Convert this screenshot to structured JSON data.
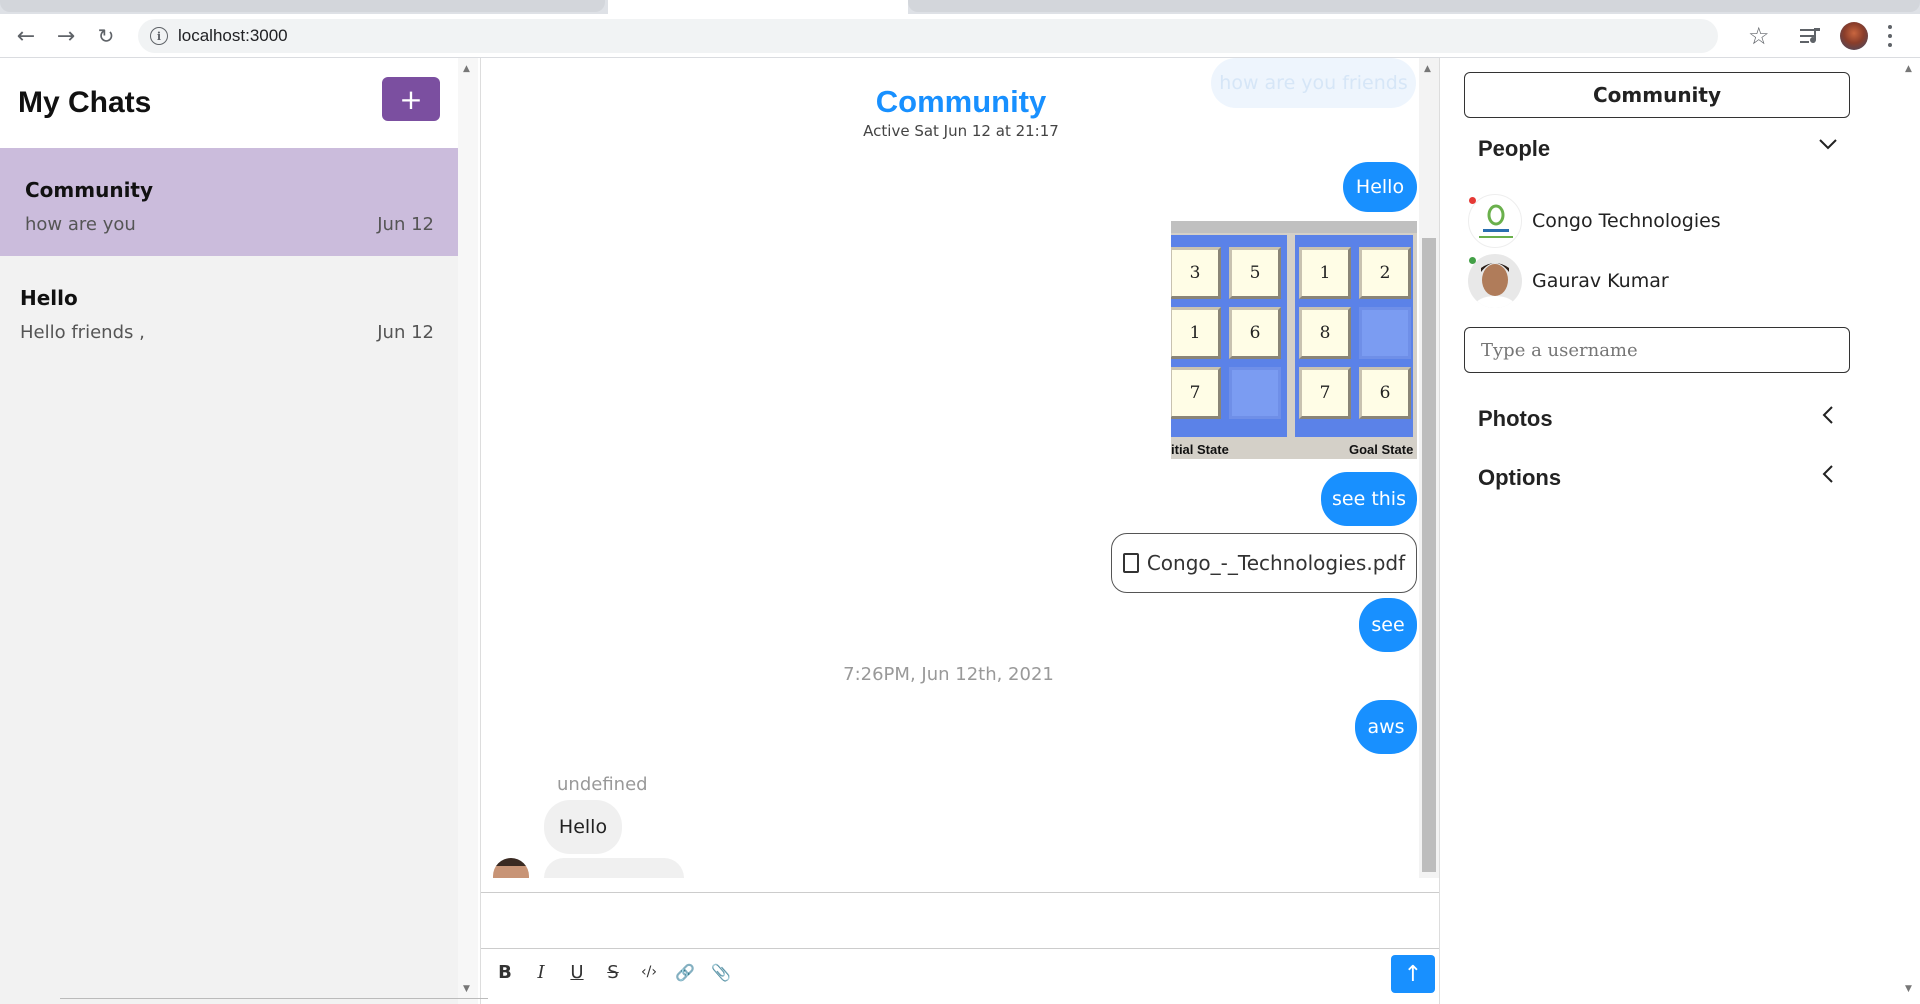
{
  "browser": {
    "url": "localhost:3000"
  },
  "left": {
    "title": "My Chats",
    "add_label": "+",
    "chats": [
      {
        "name": "Community",
        "last": "how are you",
        "date": "Jun 12"
      },
      {
        "name": "Hello",
        "last": "Hello friends ,",
        "date": "Jun 12"
      }
    ]
  },
  "chat": {
    "title": "Community",
    "subtitle": "Active Sat Jun 12 at 21:17",
    "ghost_message": "how are you friends",
    "messages": [
      {
        "text": "Hello"
      },
      {
        "text": "see this"
      },
      {
        "text": "see"
      },
      {
        "text": "aws"
      }
    ],
    "file_name": "Congo_-_Technologies.pdf",
    "timestamp": "7:26PM, Jun 12th, 2021",
    "sender": "undefined",
    "incoming": "Hello",
    "image": {
      "tiles_left": [
        "3",
        "5",
        "1",
        "6",
        "7",
        ""
      ],
      "tiles_right": [
        "1",
        "2",
        "8",
        "",
        "7",
        "6"
      ],
      "caption_left": "itial State",
      "caption_right": "Goal State"
    }
  },
  "toolbar": {
    "bold": "B",
    "italic": "I",
    "underline": "U",
    "strike": "S",
    "code": "‹/›",
    "link": "🔗",
    "attach": "📎",
    "send": "↑"
  },
  "right": {
    "title": "Community",
    "people_label": "People",
    "people": [
      {
        "name": "Congo Technologies",
        "status_color": "#e53935"
      },
      {
        "name": "Gaurav Kumar",
        "status_color": "#43a047"
      }
    ],
    "username_placeholder": "Type a username",
    "photos_label": "Photos",
    "options_label": "Options"
  }
}
